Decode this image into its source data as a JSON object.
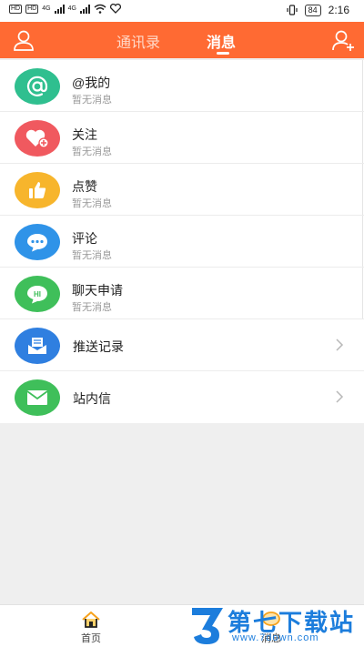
{
  "status_bar": {
    "sim1": "HD",
    "sim2": "HD",
    "net1": "4G",
    "net2": "4G",
    "battery": "84",
    "time": "2:16"
  },
  "header": {
    "tabs": [
      {
        "label": "通讯录",
        "active": false
      },
      {
        "label": "消息",
        "active": true
      }
    ],
    "accent": "#ff6a33"
  },
  "messages": [
    {
      "title": "@我的",
      "subtitle": "暂无消息",
      "icon": "at-icon",
      "color": "#2fbf8f"
    },
    {
      "title": "关注",
      "subtitle": "暂无消息",
      "icon": "heart-plus-icon",
      "color": "#f0595f"
    },
    {
      "title": "点赞",
      "subtitle": "暂无消息",
      "icon": "thumbs-up-icon",
      "color": "#f7b52c"
    },
    {
      "title": "评论",
      "subtitle": "暂无消息",
      "icon": "comment-icon",
      "color": "#2f93e8"
    },
    {
      "title": "聊天申请",
      "subtitle": "暂无消息",
      "icon": "chat-hi-icon",
      "color": "#3fbf5a"
    }
  ],
  "entries": [
    {
      "title": "推送记录",
      "icon": "push-inbox-icon",
      "color": "#2f7fe0"
    },
    {
      "title": "站内信",
      "icon": "envelope-icon",
      "color": "#3fbf5a"
    }
  ],
  "bottom_nav": [
    {
      "label": "首页",
      "icon": "home-icon"
    },
    {
      "label": "消息",
      "icon": "message-icon"
    }
  ],
  "watermark": {
    "name": "第七下载站",
    "url": "www.7down.com"
  }
}
